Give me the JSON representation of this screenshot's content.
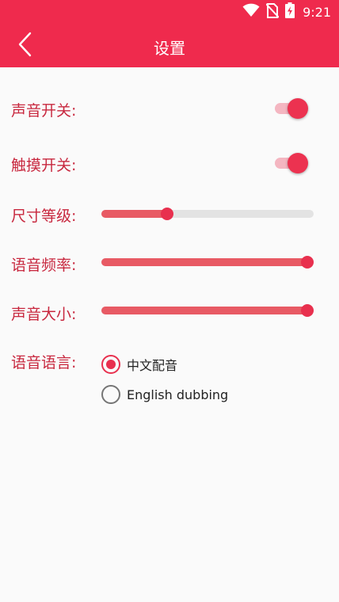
{
  "status_bar": {
    "time": "9:21",
    "icons": [
      "wifi-icon",
      "no-sim-icon",
      "battery-charging-icon"
    ]
  },
  "app_bar": {
    "title": "设置",
    "back_icon": "chevron-left-icon"
  },
  "settings": {
    "sound_switch": {
      "label": "声音开关:",
      "on": true
    },
    "touch_switch": {
      "label": "触摸开关:",
      "on": true
    },
    "size_level": {
      "label": "尺寸等级:",
      "value_fraction": 0.31
    },
    "voice_rate": {
      "label": "语音频率:",
      "value_fraction": 0.97
    },
    "volume": {
      "label": "声音大小:",
      "value_fraction": 0.97
    },
    "voice_language": {
      "label": "语音语言:",
      "options": [
        {
          "label": "中文配音",
          "selected": true
        },
        {
          "label": "English dubbing",
          "selected": false
        }
      ]
    }
  },
  "colors": {
    "accent": "#ef2a4d",
    "label_text": "#c8283f",
    "slider_fill": "#e85a64",
    "slider_rail": "#e3e3e3",
    "switch_track": "#f4b6c1"
  }
}
